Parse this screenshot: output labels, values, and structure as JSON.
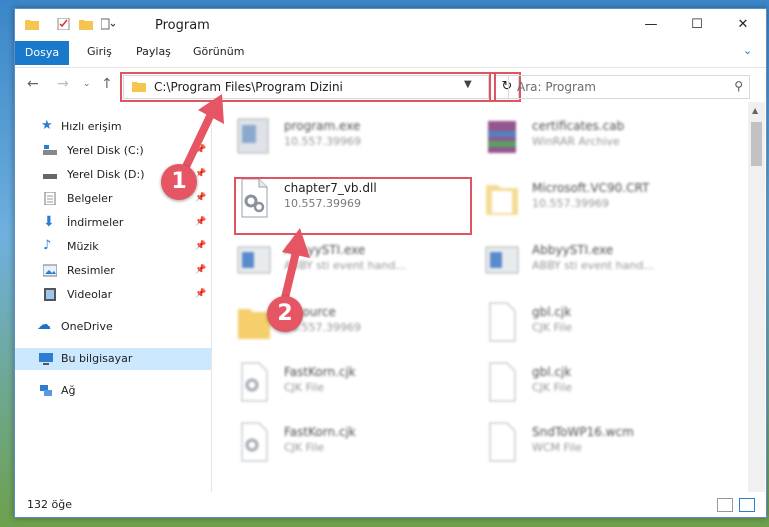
{
  "window": {
    "title": "Program"
  },
  "ribbon": {
    "tabs": [
      "Dosya",
      "Giriş",
      "Paylaş",
      "Görünüm"
    ]
  },
  "address": {
    "path": "C:\\Program Files\\Program Dizini"
  },
  "search": {
    "placeholder": "Ara: Program"
  },
  "sidebar": {
    "items": [
      {
        "label": "Hızlı erişim"
      },
      {
        "label": "Yerel Disk (C:)"
      },
      {
        "label": "Yerel Disk (D:)"
      },
      {
        "label": "Belgeler"
      },
      {
        "label": "İndirmeler"
      },
      {
        "label": "Müzik"
      },
      {
        "label": "Resimler"
      },
      {
        "label": "Videolar"
      },
      {
        "label": "OneDrive"
      },
      {
        "label": "Bu bilgisayar"
      },
      {
        "label": "Ağ"
      }
    ]
  },
  "files": [
    {
      "name": "program.exe",
      "sub": "10.557.39969"
    },
    {
      "name": "certificates.cab",
      "sub": "WinRAR Archive"
    },
    {
      "name": "chapter7_vb.dll",
      "sub": "10.557.39969"
    },
    {
      "name": "Microsoft.VC90.CRT",
      "sub": "10.557.39969"
    },
    {
      "name": "AbbyySTI.exe",
      "sub": "ABBY sti event hand..."
    },
    {
      "name": "AbbyySTI.exe",
      "sub": "ABBY sti event hand..."
    },
    {
      "name": "resource",
      "sub": "10.557.39969"
    },
    {
      "name": "gbl.cjk",
      "sub": "CJK File"
    },
    {
      "name": "FastKorn.cjk",
      "sub": "CJK File"
    },
    {
      "name": "gbl.cjk",
      "sub": "CJK File"
    },
    {
      "name": "FastKorn.cjk",
      "sub": "CJK File"
    },
    {
      "name": "SndToWP16.wcm",
      "sub": "WCM File"
    }
  ],
  "status": {
    "count": "132 öğe"
  },
  "callouts": [
    "1",
    "2"
  ],
  "colors": {
    "accent": "#1979ca",
    "highlight": "#e05461",
    "selected": "#cce8ff"
  }
}
